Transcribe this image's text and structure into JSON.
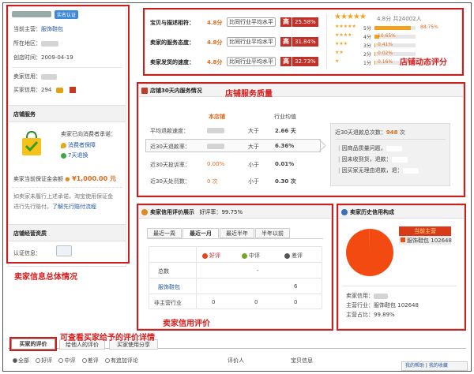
{
  "left": {
    "badge": "实名认证",
    "main_biz_label": "当前主营：",
    "main_biz_value": "服饰鞋包",
    "region_label": "所在地区：",
    "created_label": "创店时间：",
    "created_value": "2009-04-19",
    "seller_credit_label": "卖家信用：",
    "buyer_credit_label": "买家信用：",
    "buyer_credit_value": "294",
    "service_title": "店铺服务",
    "service_promise": "卖家已向消费者承诺：",
    "service_items": [
      "消费者保障",
      "7天退换"
    ],
    "deposit_label": "卖家当前保证金余额",
    "deposit_value": "1,000.00 元",
    "deposit_note_1": "如卖家未履行上述承诺，淘宝使用保证金",
    "deposit_note_2": "进行先行赔付。",
    "deposit_link": "了解先行赔付流程",
    "license_title": "店铺经营资质",
    "cert_label": "认证信息："
  },
  "ratings": {
    "rows": [
      {
        "label": "宝贝与描述相符：",
        "score": "4.8分",
        "compare": "比同行业平均水平",
        "level": "高",
        "pct": "25.58%"
      },
      {
        "label": "卖家的服务态度：",
        "score": "4.8分",
        "compare": "比同行业平均水平",
        "level": "高",
        "pct": "31.84%"
      },
      {
        "label": "卖家发货的速度：",
        "score": "4.8分",
        "compare": "比同行业平均水平",
        "level": "高",
        "pct": "32.73%"
      }
    ],
    "summary": "4.8分 共24002人",
    "dist": [
      {
        "label": "5分",
        "pct": "88.75%",
        "fraction": 0.8875
      },
      {
        "label": "4分",
        "pct": "10.65%",
        "fraction": 0.1065
      },
      {
        "label": "3分",
        "pct": "0.41%",
        "fraction": 0.0041
      },
      {
        "label": "2分",
        "pct": "0.02%",
        "fraction": 0.0002
      },
      {
        "label": "1分",
        "pct": "0.16%",
        "fraction": 0.0016
      }
    ]
  },
  "service": {
    "title": "店铺30天内服务情况",
    "col_shop": "本店铺",
    "col_industry": "行业均值",
    "rows": [
      {
        "label": "平均退款速度：",
        "shop": "",
        "cmp": "大于",
        "industry": "2.66 天"
      },
      {
        "label": "近30天退款率：",
        "shop": "",
        "cmp": "大于",
        "industry": "6.36%"
      },
      {
        "label": "近30天投诉率：",
        "shop": "0.00%",
        "cmp": "小于",
        "industry": "0.01%"
      },
      {
        "label": "近30天处罚数：",
        "shop": "0 次",
        "cmp": "小于",
        "industry": "0.30 次"
      }
    ],
    "refund_total_label": "近30天退款总次数：",
    "refund_total_value": "948",
    "refund_total_unit": "次",
    "refund_reasons": [
      "因商品质量问题，",
      "因未收到货，退款：",
      "因买家无理由退款，退："
    ]
  },
  "credit": {
    "title": "卖家信用评价展示",
    "rate_label": "好评率：",
    "rate_value": "99.75%",
    "periods": [
      "最近一周",
      "最近一月",
      "最近半年",
      "半年以前"
    ],
    "cols": [
      "好评",
      "中评",
      "差评"
    ],
    "rows": [
      {
        "label": "总数",
        "good": "",
        "mid": "",
        "bad": "-"
      },
      {
        "label": "服饰鞋包",
        "good": "",
        "mid": "",
        "bad": "6"
      },
      {
        "label": "非主营行业",
        "good": "0",
        "mid": "0",
        "bad": "0"
      }
    ]
  },
  "history": {
    "title": "卖家历史信用构成",
    "legend_current": "当前主营",
    "legend_item": "服饰鞋包",
    "legend_value": "102648",
    "info_1": "卖家信用：",
    "info_2": "主营行业：服饰鞋包",
    "info_2_value": "102648",
    "info_3": "主营占比：",
    "info_3_value": "99.89%",
    "share": 0.9989
  },
  "bottom_tabs": [
    "买家的评价",
    "给他人的评价",
    "买家使用分享"
  ],
  "filters": [
    "全部",
    "好评",
    "中评",
    "差评",
    "有追加评论"
  ],
  "filter_cols": [
    "评价人",
    "宝贝信息"
  ],
  "corner": [
    "我的帮助",
    "我的收藏"
  ],
  "annotations": {
    "rating": "店铺动态评分",
    "service": "店铺服务质量",
    "seller_info": "卖家信息总体情况",
    "credit": "卖家信用评价",
    "detail": "可查看买家给予的评价详情"
  },
  "colors": {
    "accent_red": "#c2302a",
    "annot_red": "#d71e1e",
    "star": "#f2a21c",
    "pie": "#f24a10"
  }
}
